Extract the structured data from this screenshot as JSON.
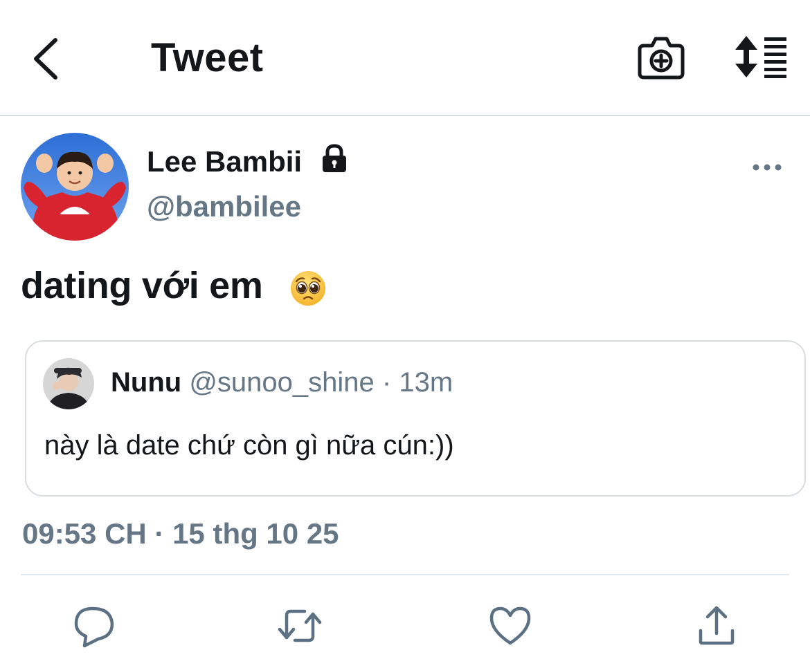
{
  "header": {
    "title": "Tweet",
    "icons": {
      "back": "chevron-left-icon",
      "camera": "camera-plus-icon",
      "sort": "sort-lines-icon"
    }
  },
  "tweet": {
    "author": {
      "name": "Lee Bambii",
      "handle": "@bambilee",
      "protected_icon": "lock-icon",
      "avatar": "avatar-child-red-sweater"
    },
    "text": "dating với em",
    "emoji": "pleading-face-emoji",
    "quoted": {
      "name": "Nunu",
      "handle": "@sunoo_shine",
      "separator": " · ",
      "time": "13m",
      "text": "này là date chứ còn gì nữa cún:))"
    },
    "timestamp": "09:53 CH · 15 thg 10 25"
  },
  "actions": [
    {
      "name": "reply",
      "icon": "reply-icon"
    },
    {
      "name": "retweet",
      "icon": "retweet-icon"
    },
    {
      "name": "like",
      "icon": "heart-icon"
    },
    {
      "name": "share",
      "icon": "share-icon"
    }
  ],
  "colors": {
    "primary_text": "#14171a",
    "secondary_text": "#657786",
    "border": "#d9dde0",
    "icon_gray": "#5b7083"
  }
}
